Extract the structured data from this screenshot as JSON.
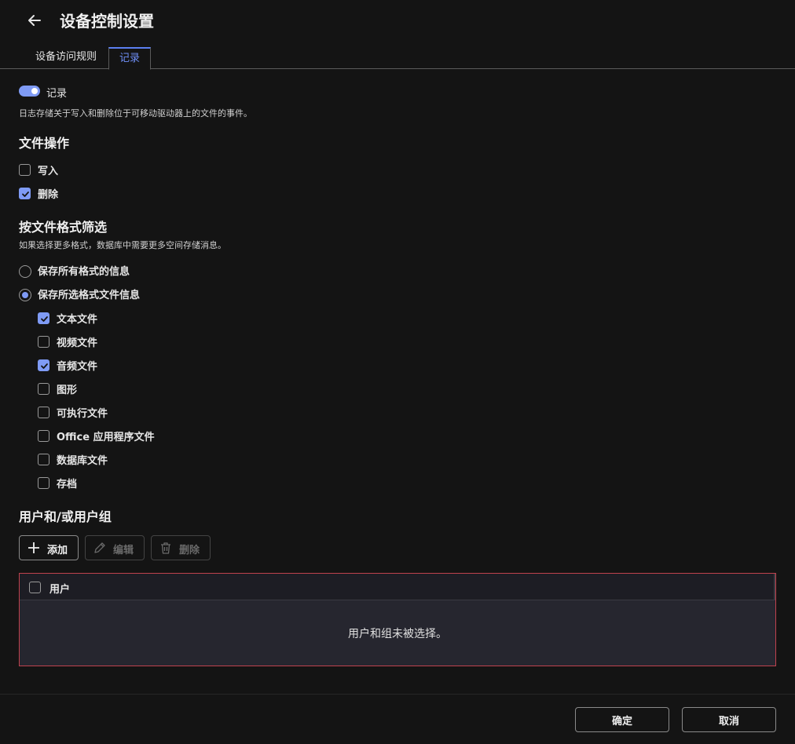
{
  "header": {
    "title": "设备控制设置",
    "back_icon": "arrow-left-icon"
  },
  "tabs": [
    {
      "label": "设备访问规则",
      "active": false
    },
    {
      "label": "记录",
      "active": true
    }
  ],
  "logging": {
    "toggle_label": "记录",
    "toggle_on": true,
    "description": "日志存储关于写入和删除位于可移动驱动器上的文件的事件。"
  },
  "file_ops": {
    "title": "文件操作",
    "items": [
      {
        "label": "写入",
        "checked": false
      },
      {
        "label": "删除",
        "checked": true
      }
    ]
  },
  "format_filter": {
    "title": "按文件格式筛选",
    "description": "如果选择更多格式，数据库中需要更多空间存储消息。",
    "options": [
      {
        "label": "保存所有格式的信息",
        "selected": false
      },
      {
        "label": "保存所选格式文件信息",
        "selected": true
      }
    ],
    "formats": [
      {
        "label": "文本文件",
        "checked": true
      },
      {
        "label": "视频文件",
        "checked": false
      },
      {
        "label": "音频文件",
        "checked": true
      },
      {
        "label": "图形",
        "checked": false
      },
      {
        "label": "可执行文件",
        "checked": false
      },
      {
        "label": "Office 应用程序文件",
        "checked": false
      },
      {
        "label": "数据库文件",
        "checked": false
      },
      {
        "label": "存档",
        "checked": false
      }
    ]
  },
  "users": {
    "title": "用户和/或用户组",
    "toolbar": {
      "add": "添加",
      "edit": "编辑",
      "delete": "删除"
    },
    "table": {
      "column_user": "用户",
      "empty_message": "用户和组未被选择。"
    }
  },
  "footer": {
    "ok": "确定",
    "cancel": "取消"
  },
  "colors": {
    "accent": "#7f9bf5",
    "error_border": "#c0424e",
    "background": "#141414"
  }
}
